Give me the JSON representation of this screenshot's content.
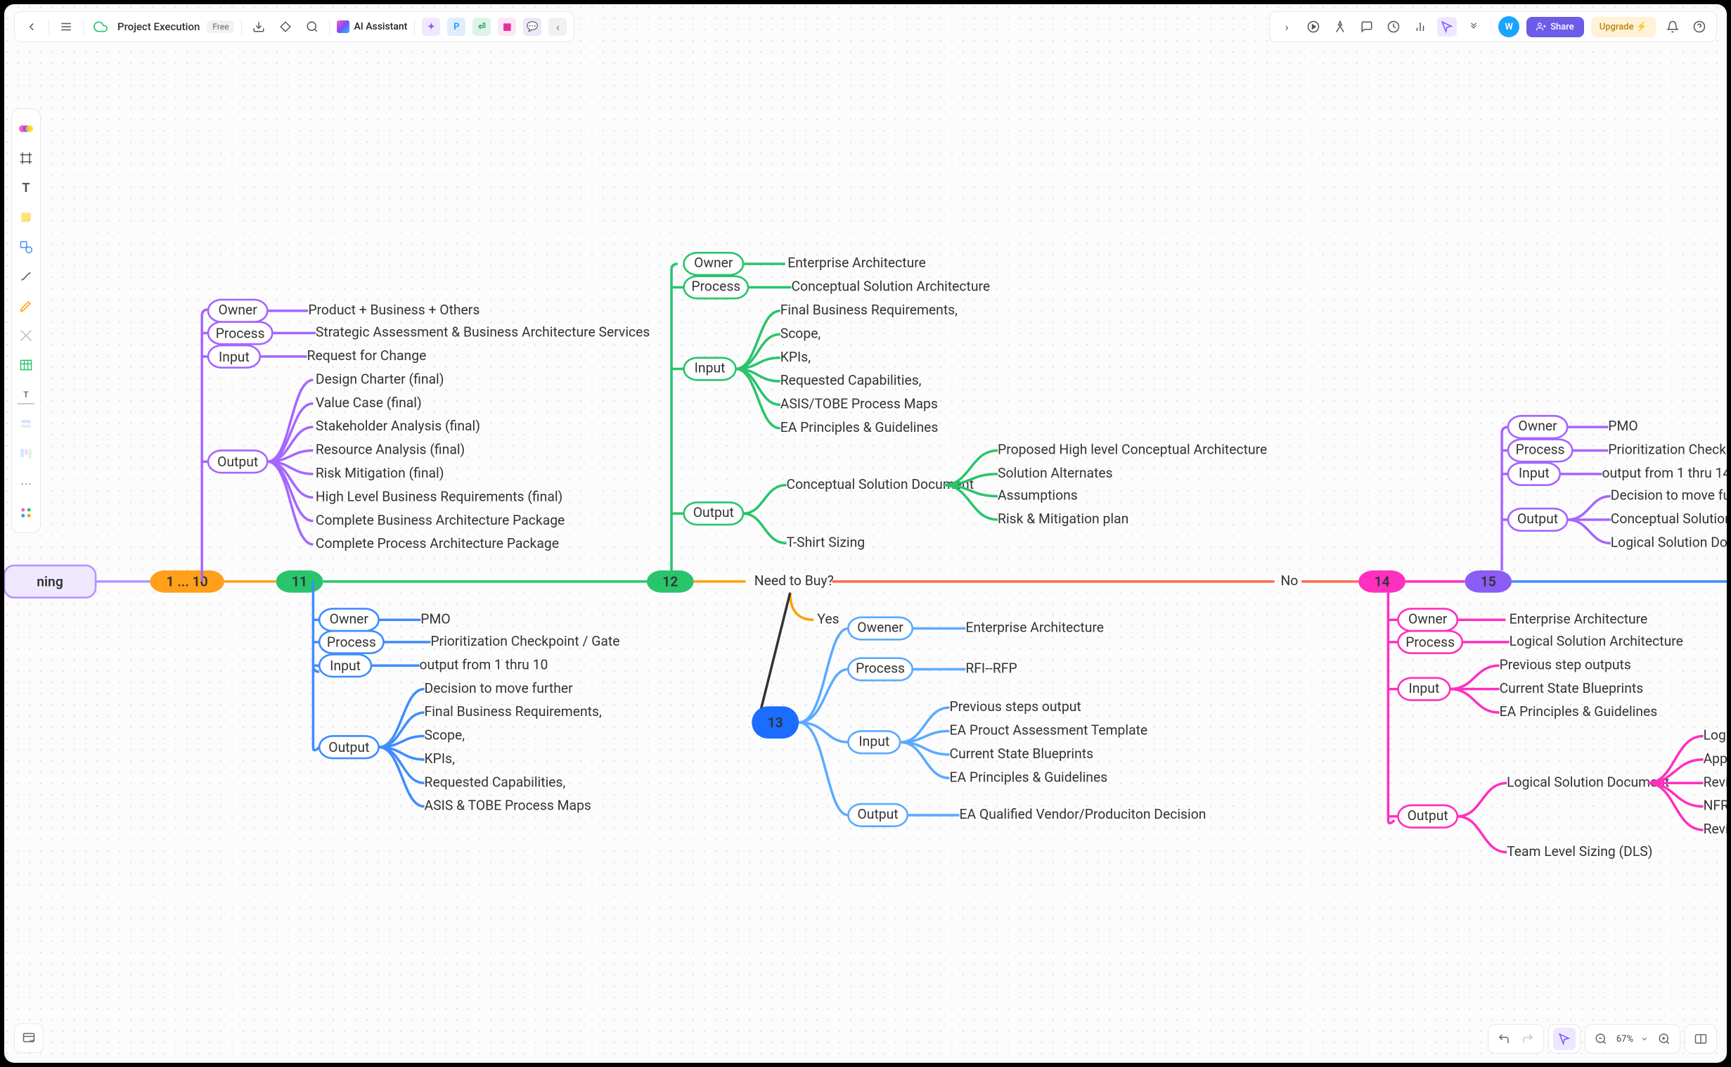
{
  "topbar": {
    "title": "Project Execution",
    "badge": "Free",
    "ai": "AI Assistant",
    "chips": {
      "p": "P"
    },
    "share": "Share",
    "upgrade": "Upgrade",
    "avatar": "W"
  },
  "status": {
    "zoom": "67%"
  },
  "central_partial": "ning",
  "flow": {
    "need_to_buy": "Need to Buy?",
    "no": "No",
    "yes": "Yes"
  },
  "n1_10": "1  ...  10",
  "n11": {
    "id": "11",
    "owner_label": "Owner",
    "process_label": "Process",
    "input_label": "Input",
    "output_label": "Output",
    "owner": "Product + Business  + Others",
    "process": "Strategic Assessment & Business Architecture Services",
    "input": "Request for Change",
    "outputs": [
      "Design Charter (final)",
      "Value Case (final)",
      "Stakeholder Analysis (final)",
      "Resource Analysis (final)",
      "Risk Mitigation (final)",
      "High Level Business Requirements (final)",
      "Complete Business Architecture Package",
      "Complete Process Architecture Package"
    ]
  },
  "nBlue": {
    "owner_label": "Owner",
    "process_label": "Process",
    "input_label": "Input",
    "output_label": "Output",
    "owner": "PMO",
    "process": "Prioritization Checkpoint / Gate",
    "input": "output from 1 thru 10",
    "outputs": [
      "Decision to move further",
      "Final Business Requirements,",
      "Scope,",
      "KPIs,",
      "Requested Capabilities,",
      "ASIS & TOBE Process Maps"
    ]
  },
  "n12": {
    "id": "12",
    "owner_label": "Owner",
    "process_label": "Process",
    "input_label": "Input",
    "output_label": "Output",
    "owner": "Enterprise Architecture",
    "process": "Conceptual Solution Architecture",
    "inputs": [
      "Final Business Requirements,",
      "Scope,",
      "KPIs,",
      "Requested Capabilities,",
      "ASIS/TOBE Process Maps",
      "EA Principles & Guidelines"
    ],
    "csd_label": "Conceptual Solution Document",
    "csd": [
      "Proposed High level Conceptual  Architecture",
      "Solution Alternates",
      "Assumptions",
      "Risk & Mitigation plan"
    ],
    "tshirt": "T-Shirt Sizing"
  },
  "n13": {
    "id": "13",
    "owner_label": "Owener",
    "process_label": "Process",
    "input_label": "Input",
    "output_label": "Output",
    "owner": "Enterprise Architecture",
    "process": "RFI--RFP",
    "inputs": [
      "Previous steps output",
      "EA Prouct Assessment Template",
      "Current State Blueprints",
      "EA Principles & Guidelines"
    ],
    "output": "EA Qualified Vendor/Produciton Decision"
  },
  "n14": {
    "id": "14",
    "owner_label": "Owner",
    "process_label": "Process",
    "input_label": "Input",
    "output_label": "Output",
    "owner": "Enterprise Architecture",
    "process": "Logical Solution Architecture",
    "inputs": [
      "Previous step outputs",
      "Current State Blueprints",
      "EA Principles & Guidelines"
    ],
    "lsd_label": "Logical Solution Document",
    "lsd": [
      "Logic",
      "Applic",
      "Revis",
      "NFRs",
      "Revis"
    ],
    "team": "Team Level Sizing (DLS)"
  },
  "n15": {
    "id": "15",
    "owner_label": "Owner",
    "process_label": "Process",
    "input_label": "Input",
    "output_label": "Output",
    "owner": "PMO",
    "process": "Prioritization Checkpo",
    "input": "output from 1 thru 14",
    "outputs": [
      "Decision to move furthe",
      "Conceptual Solution Do",
      "Logical Solution Docum"
    ]
  }
}
